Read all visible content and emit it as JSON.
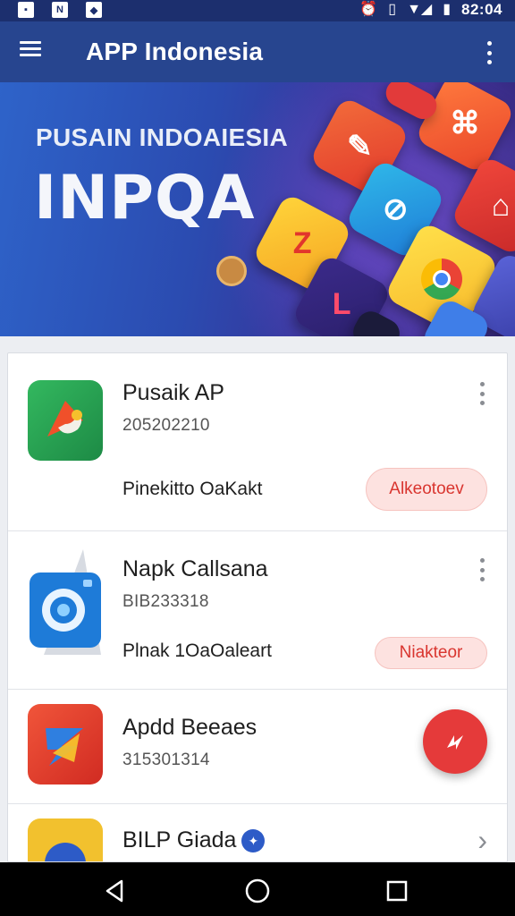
{
  "status_bar": {
    "time": "82:04",
    "left_icons": [
      "app-notification-icon",
      "nfc-icon",
      "shield-notification-icon"
    ],
    "right_icons": [
      "alarm-icon",
      "vibrate-icon",
      "signal-icon",
      "battery-icon"
    ]
  },
  "app_bar": {
    "title": "APP Indonesia",
    "menu_icon": "hamburger-menu-icon",
    "overflow_icon": "more-vert-icon"
  },
  "banner": {
    "subtitle": "PUSAIN INDOAIESIA",
    "title": "INPQA"
  },
  "apps": [
    {
      "name": "Pusaik AP",
      "code": "205202210",
      "description": "Pinekitto OaKakt",
      "action_label": "Alkeotoev",
      "action_type": "pill",
      "icon": "green-play-app-icon",
      "accent": "#2aa45a"
    },
    {
      "name": "Napk Callsana",
      "code": "BIB233318",
      "description": "Plnak 1OaOaleart",
      "action_label": "Niakteor",
      "action_type": "pill",
      "icon": "blue-camera-app-icon",
      "accent": "#1e7bd8"
    },
    {
      "name": "Apdd Beeaes",
      "code": "315301314",
      "description": "",
      "action_label": "",
      "action_type": "fab",
      "icon": "red-bolt-app-icon",
      "accent": "#e23b2e"
    },
    {
      "name": "BILP Giada",
      "code": "",
      "description": "",
      "action_label": "",
      "action_type": "chevron",
      "icon": "yellow-blue-app-icon",
      "accent": "#f2c12e"
    }
  ],
  "nav_bar": {
    "buttons": [
      "back-icon",
      "home-icon",
      "recents-icon"
    ]
  },
  "colors": {
    "app_bar": "#27458f",
    "status_bar": "#1c2f6e",
    "pill_bg": "#fde2e0",
    "pill_text": "#d9352f",
    "fab": "#e53a3a"
  }
}
